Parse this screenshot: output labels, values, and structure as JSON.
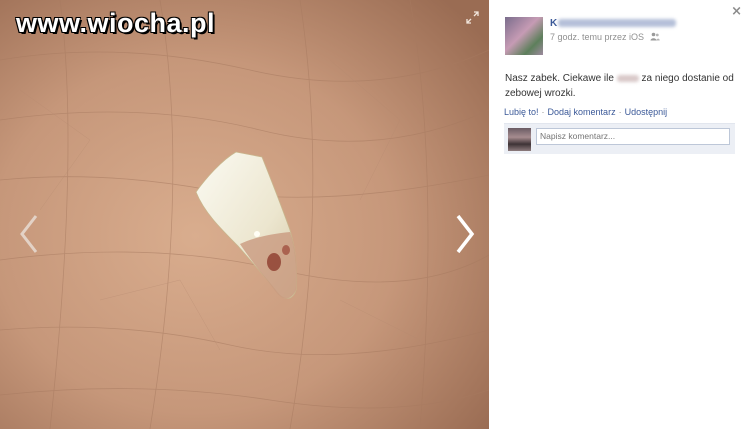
{
  "watermark": {
    "text": "www.wiocha.pl"
  },
  "viewer": {
    "photo_alt": "tooth on palm",
    "prev_icon": "chevron-left-icon",
    "next_icon": "chevron-right-icon",
    "expand_icon": "expand-icon",
    "close_label": "×"
  },
  "post": {
    "author_initial": "K",
    "time_text": "7 godz. temu przez iOS",
    "audience_icon": "people-icon",
    "text_part1": "Nasz zabek. Ciekawe ile",
    "text_part2": "za niego dostanie od zebowej wrozki.",
    "actions": {
      "like": "Lubię to!",
      "comment": "Dodaj komentarz",
      "share": "Udostępnij",
      "separator": "·"
    },
    "comment_placeholder": "Napisz komentarz..."
  },
  "colors": {
    "link": "#3b5998",
    "panel_bg": "#ffffff",
    "comment_bg": "#eceff5"
  }
}
